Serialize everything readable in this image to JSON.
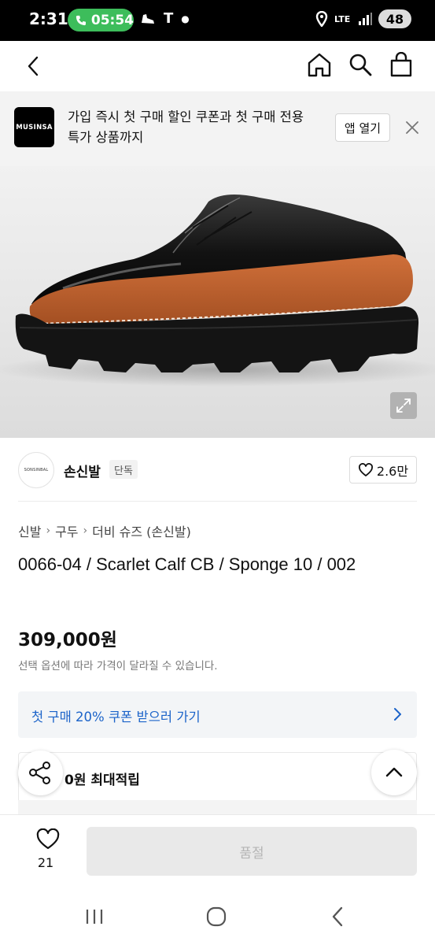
{
  "status_bar": {
    "time": "2:31",
    "call_timer": "05:54",
    "carrier_icon": "T",
    "network_label": "LTE",
    "battery": "48"
  },
  "app_header": {
    "back_icon": "chevron-left",
    "home_icon": "home",
    "search_icon": "search",
    "cart_icon": "shopping-bag"
  },
  "promo": {
    "logo_text": "MUSINSA",
    "message": "가입 즉시 첫 구매 할인 쿠폰과 첫 구매 전용 특가 상품까지",
    "open_app_label": "앱 열기"
  },
  "product": {
    "image_alt_icon": "expand",
    "brand_logo_text": "SONSINBAL",
    "brand_name": "손신발",
    "brand_tag": "단독",
    "like_count": "2.6만",
    "breadcrumb": [
      "신발",
      "구두",
      "더비 슈즈 (손신발)"
    ],
    "title": "0066-04 / Scarlet Calf CB / Sponge 10 / 002",
    "price": "309,000원",
    "price_note": "선택 옵션에 따라 가격이 달라질 수 있습니다.",
    "coupon_label": "첫 구매 20% 쿠폰 받으러 가기",
    "points_label": "0원 최대적립"
  },
  "bottom_bar": {
    "wish_count": "21",
    "sold_out_label": "품절"
  },
  "colors": {
    "accent_green": "#3dbd5b",
    "coupon_blue": "#1b63c9",
    "shoe_orange": "#c0622f"
  }
}
